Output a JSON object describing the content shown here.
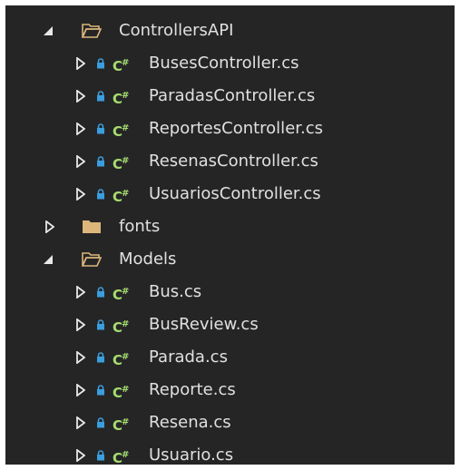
{
  "tree": [
    {
      "label": "ControllersAPI",
      "type": "folder",
      "expanded": true,
      "level": 1
    },
    {
      "label": "BusesController.cs",
      "type": "csfile",
      "level": 2
    },
    {
      "label": "ParadasController.cs",
      "type": "csfile",
      "level": 2
    },
    {
      "label": "ReportesController.cs",
      "type": "csfile",
      "level": 2
    },
    {
      "label": "ResenasController.cs",
      "type": "csfile",
      "level": 2
    },
    {
      "label": "UsuariosController.cs",
      "type": "csfile",
      "level": 2
    },
    {
      "label": "fonts",
      "type": "folder",
      "expanded": false,
      "level": 1
    },
    {
      "label": "Models",
      "type": "folder",
      "expanded": true,
      "level": 1
    },
    {
      "label": "Bus.cs",
      "type": "csfile",
      "level": 2
    },
    {
      "label": "BusReview.cs",
      "type": "csfile",
      "level": 2
    },
    {
      "label": "Parada.cs",
      "type": "csfile",
      "level": 2
    },
    {
      "label": "Reporte.cs",
      "type": "csfile",
      "level": 2
    },
    {
      "label": "Resena.cs",
      "type": "csfile",
      "level": 2
    },
    {
      "label": "Usuario.cs",
      "type": "csfile",
      "level": 2
    }
  ],
  "icons": {
    "csharp_badge": "C#",
    "folder_color": "#dcb67a",
    "lock_color": "#3b9ede",
    "csharp_color": "#a6dd6f"
  }
}
